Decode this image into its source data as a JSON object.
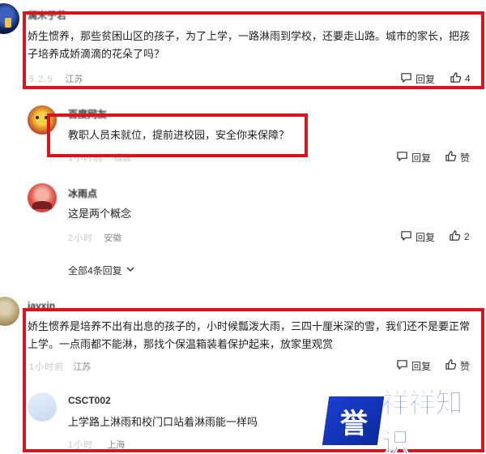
{
  "comments": [
    {
      "name": "澜米子若",
      "text": "娇生惯养，那些贫困山区的孩子，为了上学，一路淋雨到学校，还要走山路。城市的家长，把孩子培养成娇滴滴的花朵了吗？",
      "meta_blur": "5.2.5",
      "location": "江苏",
      "reply_label": "回复",
      "like_count": "4"
    },
    {
      "name": "百度网友",
      "text": "教职人员未就位，提前进校园，安全你来保障？",
      "meta_blur": "1小时前 · 福建",
      "reply_label": "回复",
      "like_label": "赞"
    },
    {
      "name": "冰雨点",
      "text": "这是两个概念",
      "meta_blur": "2小时",
      "location": "安徽",
      "reply_label": "回复",
      "like_count": "2"
    },
    {
      "name": "jayxin",
      "text": "娇生惯养是培养不出有出息的孩子的，小时候瓢泼大雨，三四十厘米深的雪，我们还不是要正常上学。一点雨都不能淋，那找个保温箱装着保护起来，放家里观赏",
      "meta_blur": "1小时前",
      "location": "江苏",
      "reply_label": "回复",
      "like_label": "赞"
    },
    {
      "name": "CSCT002",
      "text": "上学路上淋雨和校门口站着淋雨能一样吗",
      "meta_blur": "1小时",
      "location": "上海"
    }
  ],
  "show_all_replies": "全部4条回复",
  "watermark": {
    "tile": "誉",
    "text": "祥祥知识"
  },
  "colors": {
    "highlight": "#d8141c",
    "brand": "#1a3fd1"
  }
}
